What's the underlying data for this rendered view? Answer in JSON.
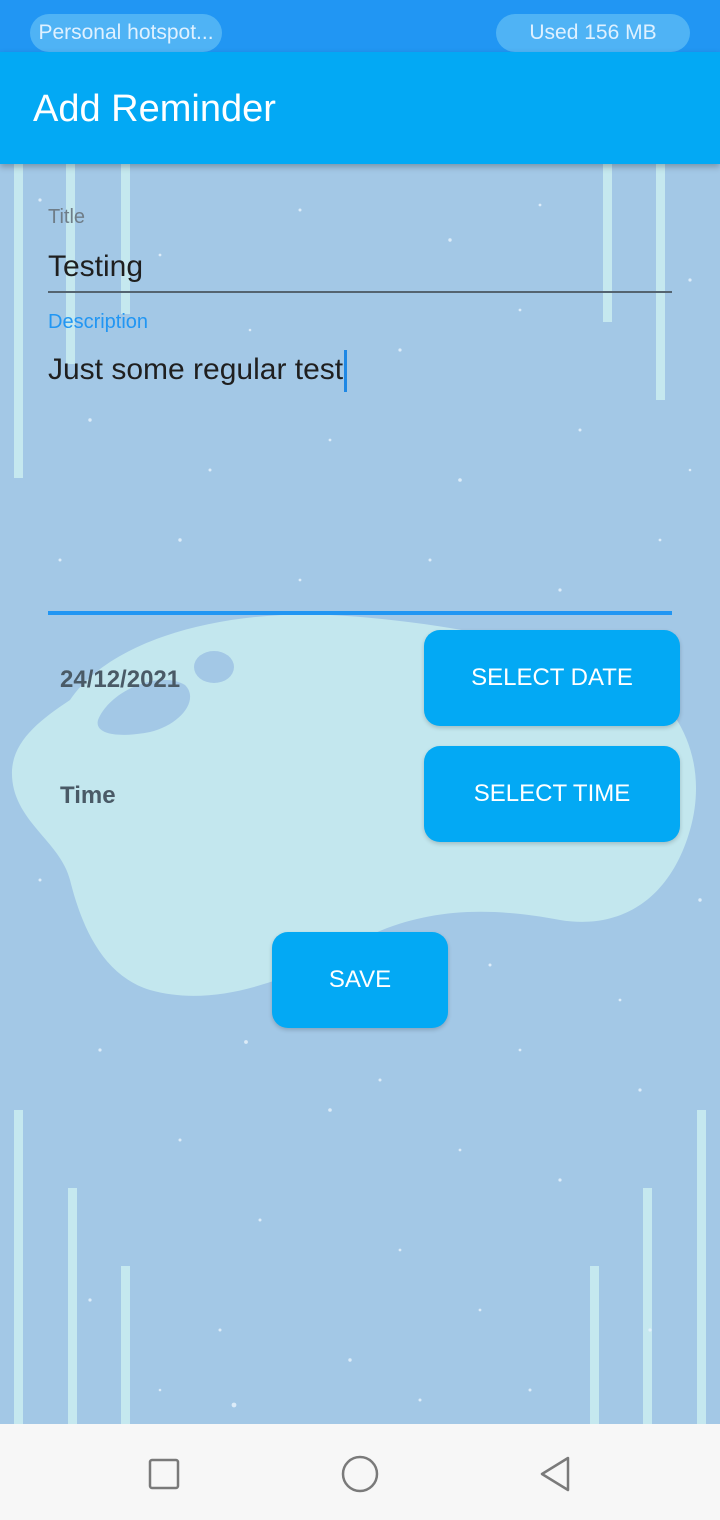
{
  "status_bar": {
    "hotspot_label": "Personal hotspot...",
    "data_usage": "Used  156 MB"
  },
  "app_bar": {
    "title": "Add Reminder"
  },
  "form": {
    "title_label": "Title",
    "title_value": "Testing",
    "description_label": "Description",
    "description_value": "Just some regular test",
    "date_value": "24/12/2021",
    "select_date_label": "SELECT DATE",
    "time_value": "Time",
    "select_time_label": "SELECT TIME",
    "save_label": "SAVE"
  },
  "nav_bar": {
    "icons": [
      "recents-square-icon",
      "home-circle-icon",
      "back-triangle-icon"
    ]
  },
  "colors": {
    "status_bar": "#2196f3",
    "app_bar": "#03a9f4",
    "button": "#03a9f4",
    "background": "#a3c8e6",
    "accent": "#2196f3"
  }
}
